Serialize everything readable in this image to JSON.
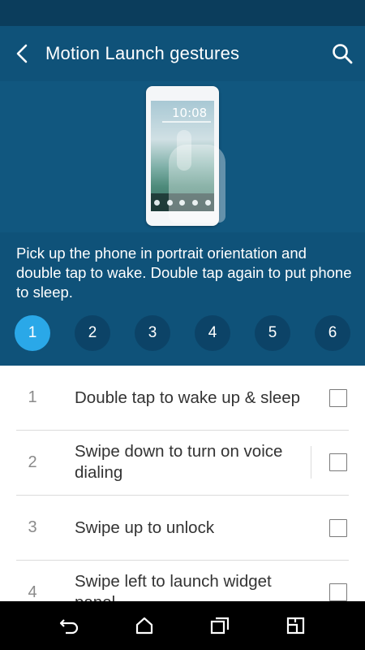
{
  "app_bar": {
    "title": "Motion Launch gestures",
    "icons": {
      "back": "chevron-left-icon",
      "search": "search-icon"
    }
  },
  "hero": {
    "phone_clock": "10:08",
    "description": "Pick up the phone in portrait orientation and double tap to wake. Double tap again to put phone to sleep."
  },
  "steps": {
    "items": [
      "1",
      "2",
      "3",
      "4",
      "5",
      "6"
    ],
    "active": "1",
    "active_color": "#2aa8e8"
  },
  "gestures": [
    {
      "number": "1",
      "label": "Double tap to wake up & sleep",
      "checked": false
    },
    {
      "number": "2",
      "label": "Swipe down to turn on voice dialing",
      "checked": false
    },
    {
      "number": "3",
      "label": "Swipe up to unlock",
      "checked": false
    },
    {
      "number": "4",
      "label": "Swipe left to launch widget panel",
      "checked": false
    }
  ],
  "nav_bar": {
    "icons": [
      "back-icon",
      "home-icon",
      "recent-apps-icon",
      "screenshot-icon"
    ]
  },
  "colors": {
    "app_bar": "#0f5279",
    "status_bar": "#0b3d5c",
    "step_inactive": "#0c4367"
  }
}
